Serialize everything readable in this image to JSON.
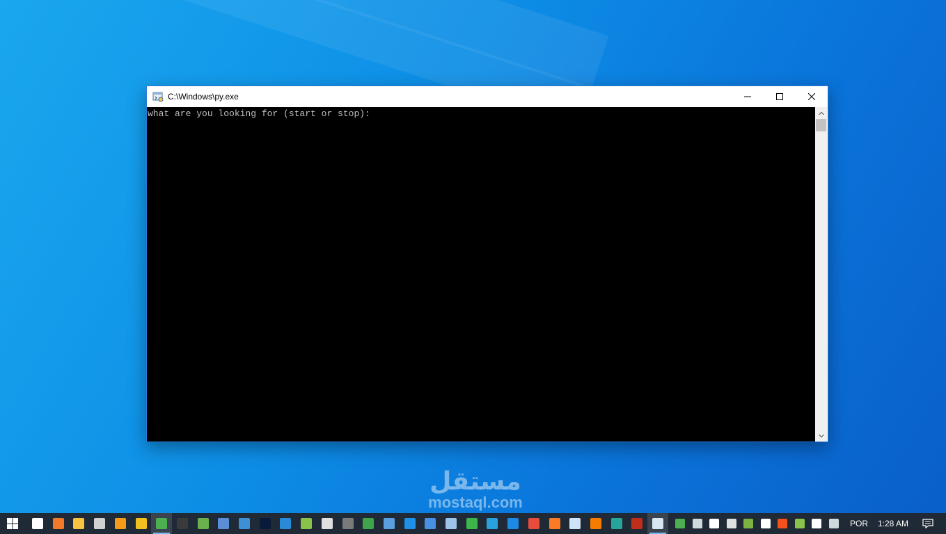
{
  "window": {
    "title": "C:\\Windows\\py.exe",
    "console_output": "what are you looking for (start or stop):"
  },
  "watermark": {
    "arabic": "مستقل",
    "latin": "mostaql.com"
  },
  "taskbar": {
    "pinned_apps": [
      {
        "name": "task-view-icon",
        "color": "#ffffff"
      },
      {
        "name": "app-orange-icon",
        "color": "#f07a2a"
      },
      {
        "name": "file-explorer-icon",
        "color": "#f5c242"
      },
      {
        "name": "app-gray-icon",
        "color": "#d0d0d0"
      },
      {
        "name": "sublime-text-icon",
        "color": "#f49b1a"
      },
      {
        "name": "app-yellow-icon",
        "color": "#f2c01e"
      },
      {
        "name": "chrome-icon",
        "color": "#4caf50"
      },
      {
        "name": "command-prompt-icon",
        "color": "#3a3a3a"
      },
      {
        "name": "remote-desktop-icon",
        "color": "#6ab04c"
      },
      {
        "name": "app-link-icon",
        "color": "#5a8fd8"
      },
      {
        "name": "app-blue-icon",
        "color": "#3d8fd6"
      },
      {
        "name": "photoshop-icon",
        "color": "#0a1a3a"
      },
      {
        "name": "vscode-icon",
        "color": "#2a8ad8"
      },
      {
        "name": "app-green-icon",
        "color": "#8bc34a"
      },
      {
        "name": "app-tool-icon",
        "color": "#e0e0e0"
      },
      {
        "name": "kali-icon",
        "color": "#7a7a7a"
      },
      {
        "name": "edge-icon",
        "color": "#3fa44a"
      },
      {
        "name": "virtualbox-icon",
        "color": "#5aa0e0"
      },
      {
        "name": "teamviewer-icon",
        "color": "#1f8fe8"
      },
      {
        "name": "app-blue2-icon",
        "color": "#4a90e2"
      },
      {
        "name": "network-icon",
        "color": "#9ec3e8"
      },
      {
        "name": "camtasia-icon",
        "color": "#3cb54a"
      },
      {
        "name": "telegram-icon",
        "color": "#2aa1de"
      },
      {
        "name": "wireshark-icon",
        "color": "#1e88e5"
      },
      {
        "name": "app-windows-icon",
        "color": "#e74c3c"
      },
      {
        "name": "xampp-icon",
        "color": "#fb7a24"
      },
      {
        "name": "notepad-icon",
        "color": "#cfe3f7"
      },
      {
        "name": "app-ring-icon",
        "color": "#f57c00"
      },
      {
        "name": "app-spark-icon",
        "color": "#26a69a"
      },
      {
        "name": "filezilla-icon",
        "color": "#bf2e1a"
      },
      {
        "name": "python-console-icon",
        "color": "#d8e6f2"
      }
    ],
    "tray_icons": [
      {
        "name": "chrome-tray-icon",
        "color": "#4caf50"
      },
      {
        "name": "network-monitor-icon",
        "color": "#cfd8dc"
      },
      {
        "name": "volume-icon",
        "color": "#ffffff"
      },
      {
        "name": "app-tray-icon",
        "color": "#e0e0e0"
      },
      {
        "name": "app-green-tray-icon",
        "color": "#7cb342"
      },
      {
        "name": "battery-icon",
        "color": "#ffffff"
      },
      {
        "name": "app-red-tray-icon",
        "color": "#f4511e"
      },
      {
        "name": "app-lime-tray-icon",
        "color": "#8bc34a"
      },
      {
        "name": "wifi-icon",
        "color": "#ffffff"
      },
      {
        "name": "display-icon",
        "color": "#cfd8dc"
      }
    ],
    "language": "POR",
    "clock": "1:28 AM"
  }
}
